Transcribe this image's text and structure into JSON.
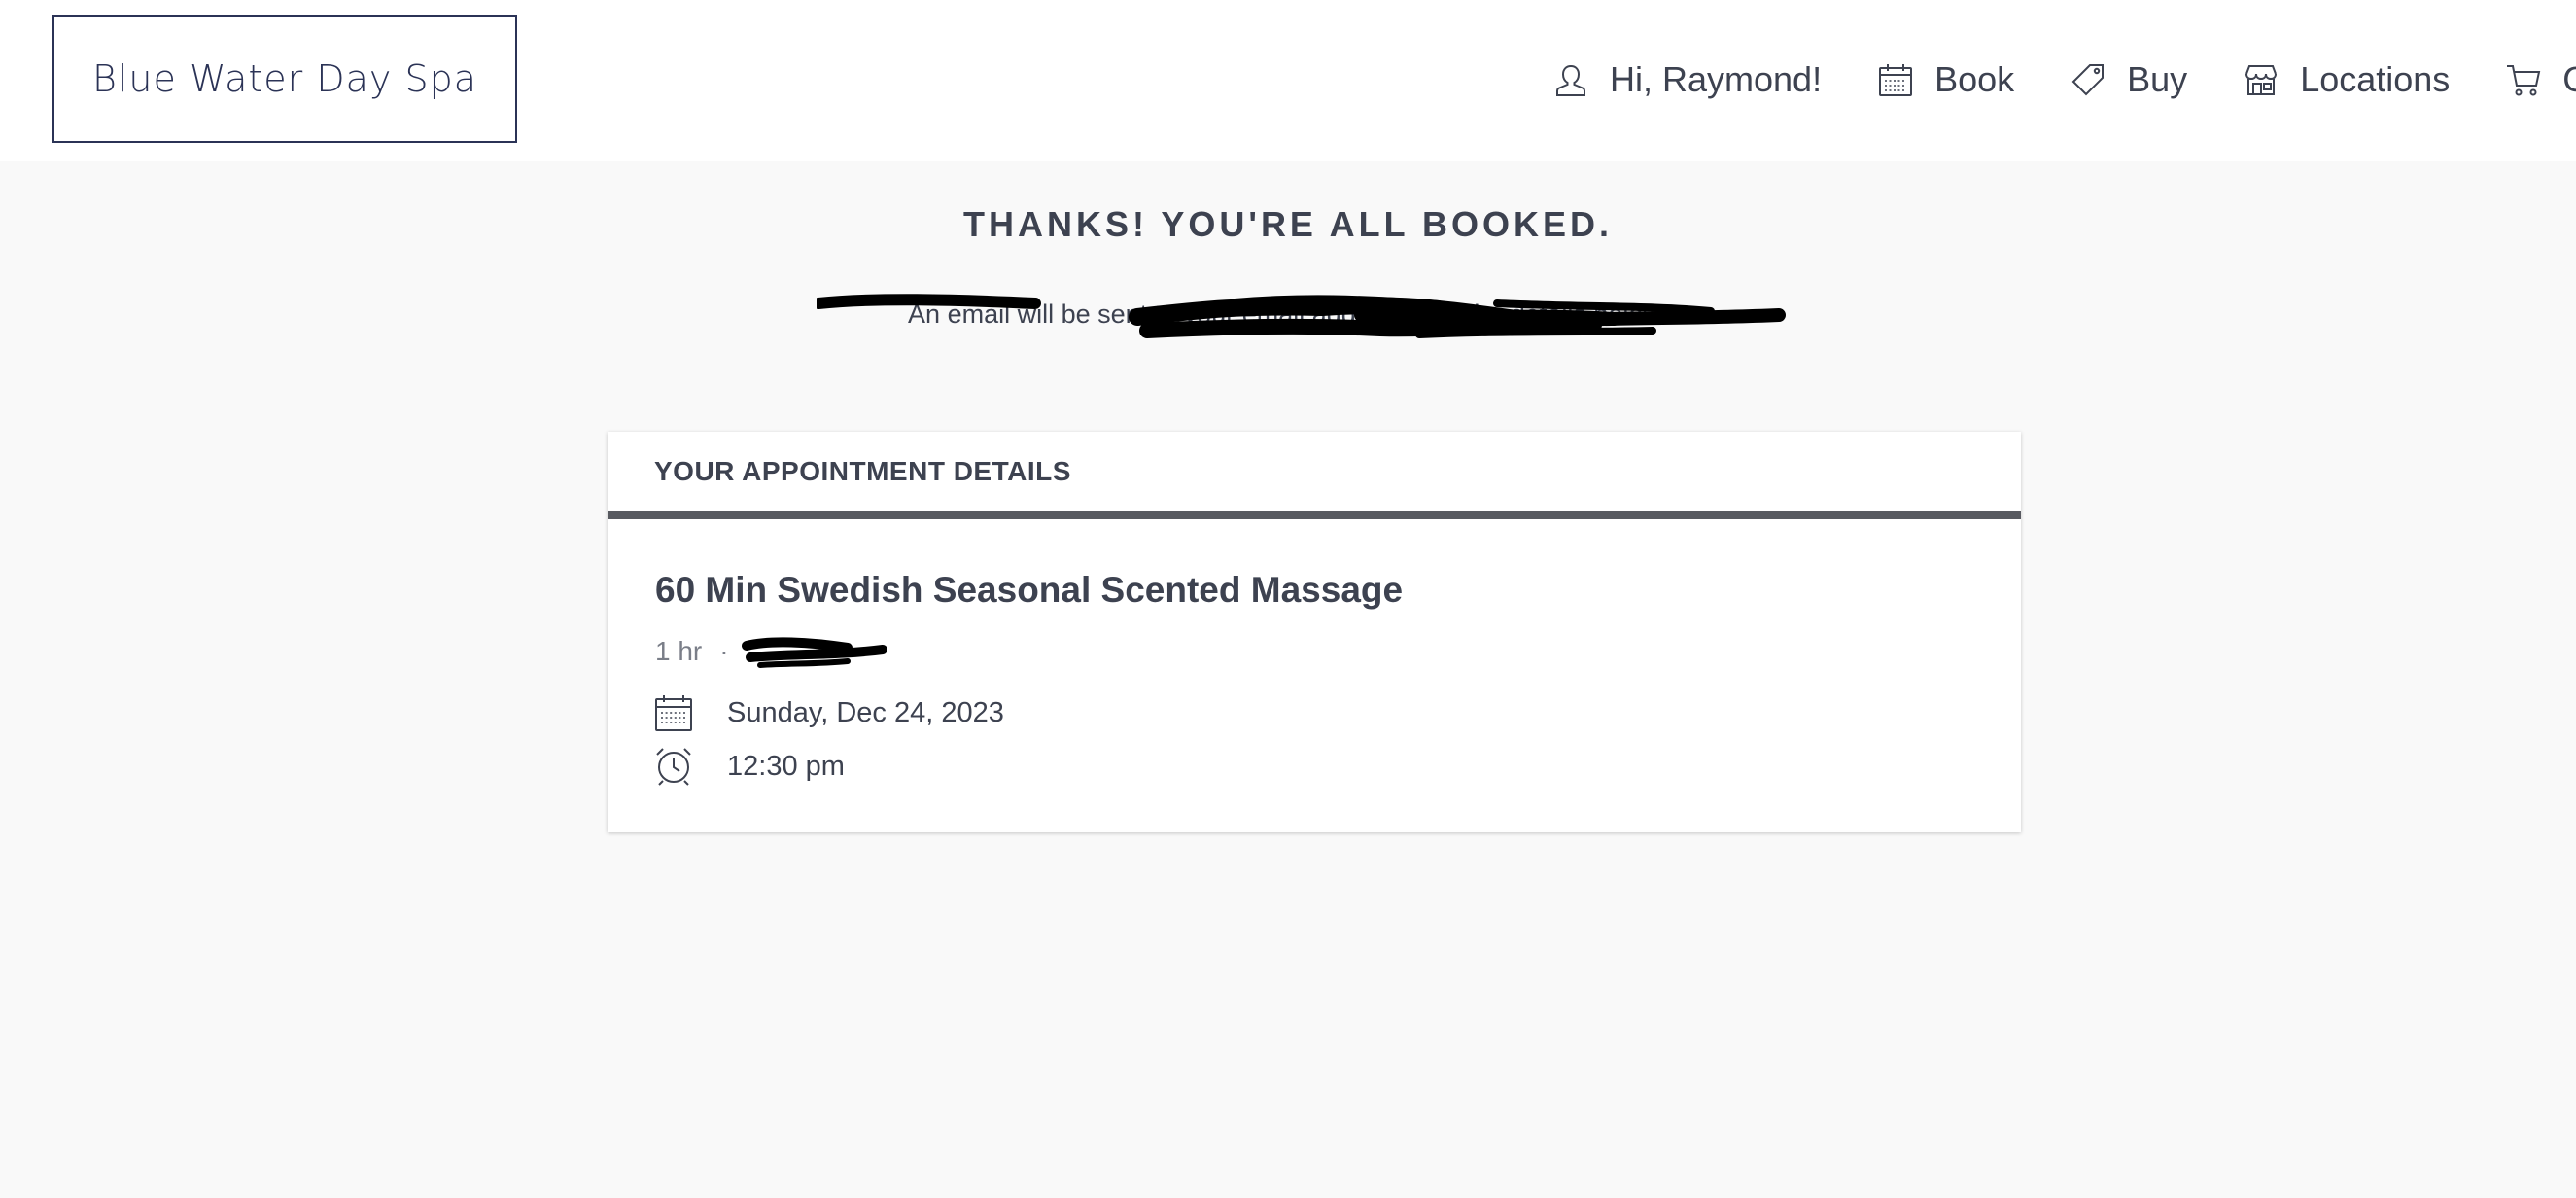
{
  "brand": {
    "logo_text": "Blue Water Day Spa",
    "color": "#2b3356"
  },
  "nav": {
    "greeting": "Hi, Raymond!",
    "book": "Book",
    "buy": "Buy",
    "locations": "Locations",
    "cart_partial": "C"
  },
  "confirmation": {
    "title": "THANKS! YOU'RE ALL BOOKED.",
    "subtitle": "An email will be sent to your email address with the details below."
  },
  "appointment": {
    "section_header": "YOUR APPOINTMENT DETAILS",
    "service_name": "60 Min Swedish Seasonal Scented Massage",
    "duration": "1 hr",
    "separator": "·",
    "date": "Sunday, Dec 24, 2023",
    "time": "12:30 pm"
  },
  "icons": {
    "user": "user-icon",
    "calendar": "calendar-icon",
    "tag": "tag-icon",
    "store": "store-icon",
    "cart": "cart-icon",
    "clock": "alarm-clock-icon"
  },
  "colors": {
    "text": "#3d4250",
    "muted": "#7a7e88",
    "background": "#f9f9f9",
    "card_rule": "#585a60"
  }
}
